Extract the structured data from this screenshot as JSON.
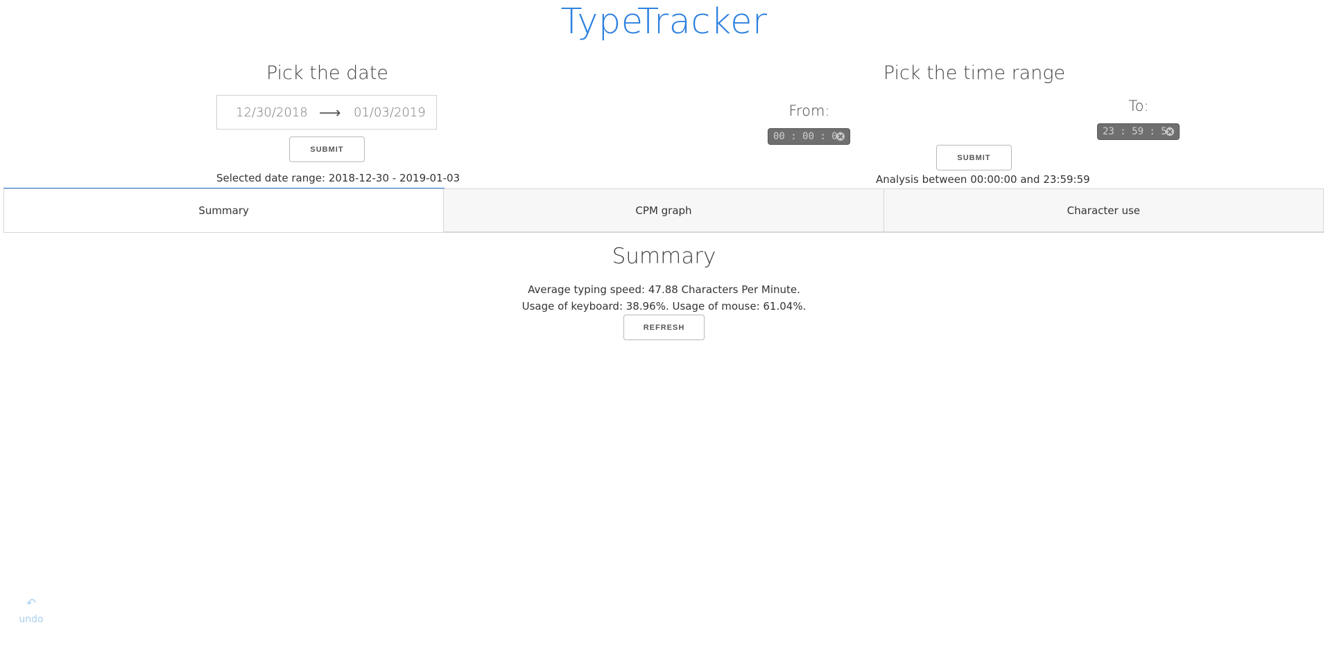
{
  "app": {
    "title": "TypeTracker"
  },
  "date_picker": {
    "heading": "Pick the date",
    "start_date": "12/30/2018",
    "arrow": "⟶",
    "end_date": "01/03/2019",
    "submit_label": "SUBMIT",
    "status": "Selected date range: 2018-12-30 - 2019-01-03"
  },
  "time_picker": {
    "heading": "Pick the time range",
    "from_label": "From:",
    "from_value": "00 : 00 : 00",
    "to_label": "To:",
    "to_value": "23 : 59 : 59",
    "submit_label": "SUBMIT",
    "status": "Analysis between 00:00:00 and 23:59:59"
  },
  "tabs": [
    {
      "label": "Summary",
      "active": true
    },
    {
      "label": "CPM graph",
      "active": false
    },
    {
      "label": "Character use",
      "active": false
    }
  ],
  "summary": {
    "title": "Summary",
    "typing_speed": "Average typing speed: 47.88 Characters Per Minute.",
    "usage": "Usage of keyboard: 38.96%. Usage of mouse: 61.04%.",
    "refresh_label": "REFRESH"
  },
  "undo": {
    "icon": "undo-icon",
    "label": "undo"
  },
  "colors": {
    "accent": "#2d80e0",
    "time_chip": "#6f6f6f",
    "undo": "#a9d0f0"
  }
}
